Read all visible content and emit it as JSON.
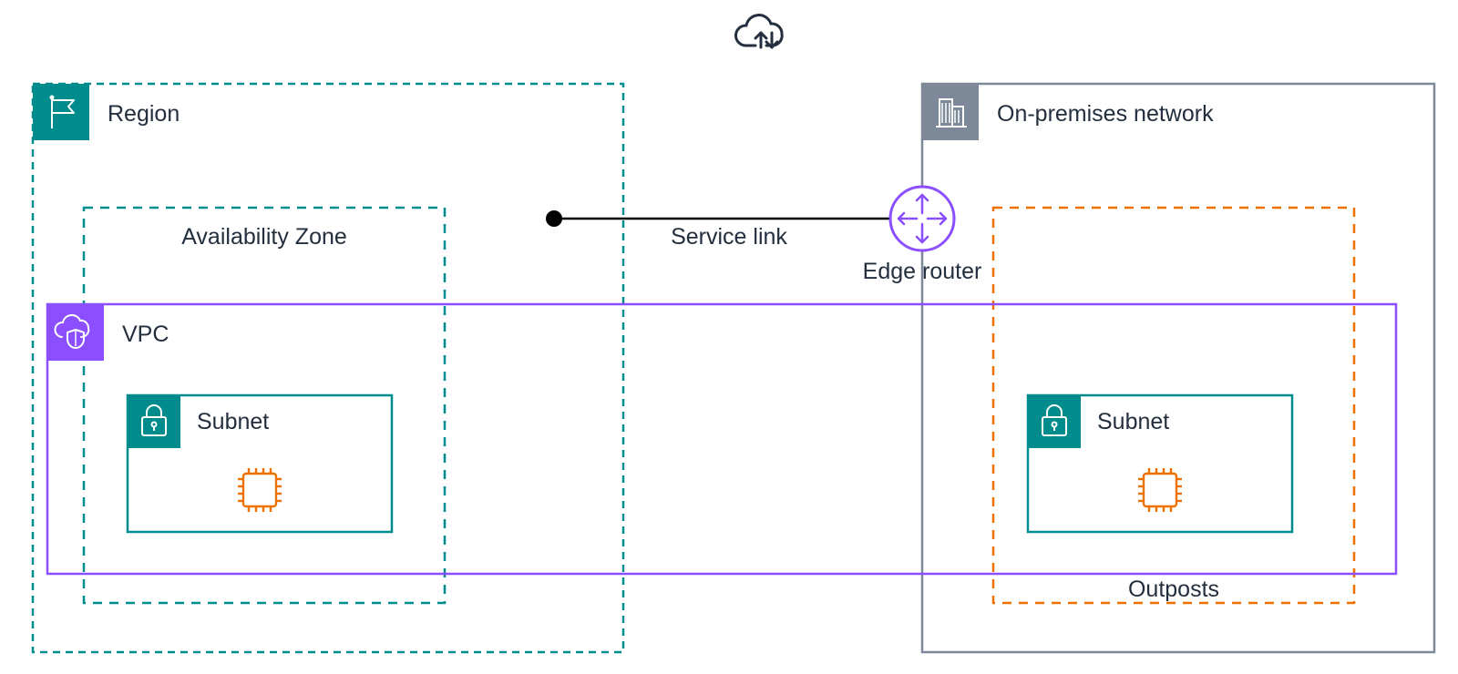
{
  "meta": {
    "description": "AWS network architecture diagram showing a Region (with an Availability Zone and VPC containing a Subnet) connected via a Service link through an Edge router to an On-premises network that hosts an Outposts deployment with a Subnet.",
    "colors": {
      "teal": "#008C8C",
      "purple": "#8C4FFF",
      "orange": "#ED7100",
      "gray": "#7D8998",
      "darkGray": "#232F3E"
    }
  },
  "labels": {
    "region": "Region",
    "availability_zone": "Availability Zone",
    "vpc": "VPC",
    "subnet_left": "Subnet",
    "subnet_right": "Subnet",
    "on_prem": "On-premises network",
    "outposts": "Outposts",
    "service_link": "Service link",
    "edge_router": "Edge router"
  },
  "icons": {
    "cloud_top": "cloud-updown-icon",
    "region_flag": "flag-icon",
    "on_prem_building": "building-icon",
    "vpc_cloud_shield": "cloud-shield-icon",
    "subnet_lock": "lock-icon",
    "cpu_chip": "cpu-icon",
    "edge_router": "router-arrows-icon"
  }
}
